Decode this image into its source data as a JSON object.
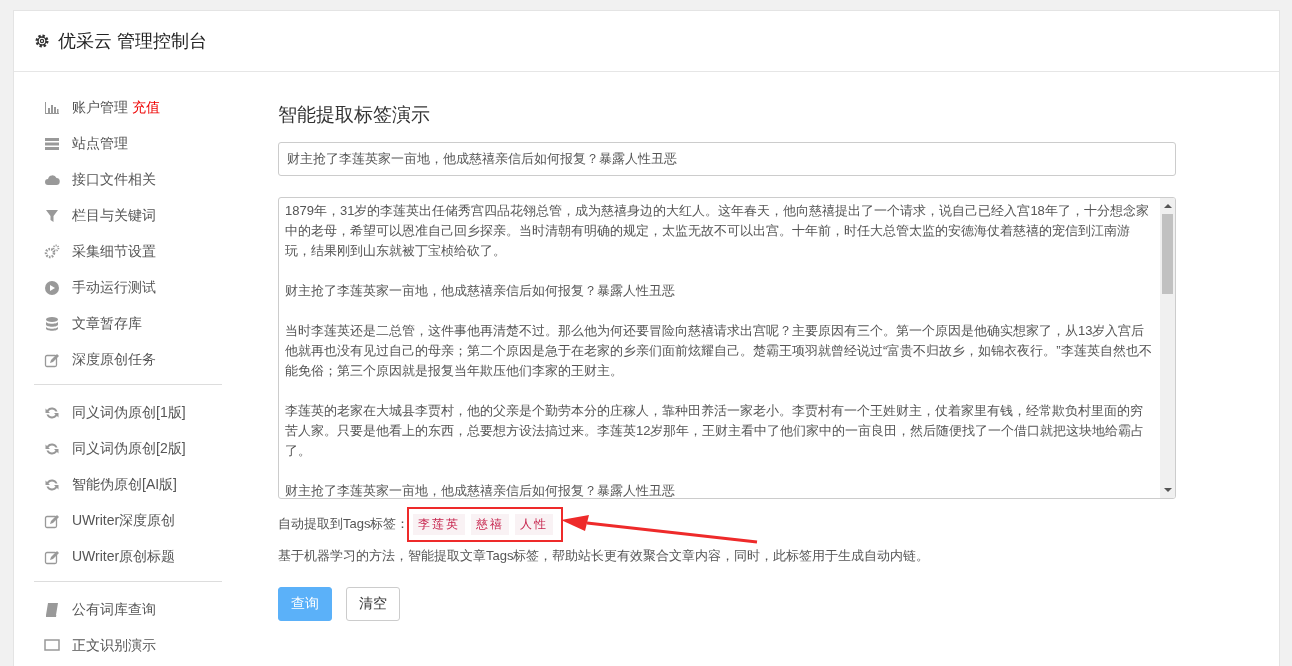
{
  "header": {
    "title": "优采云 管理控制台"
  },
  "sidebar": {
    "groups": [
      {
        "items": [
          {
            "label": "账户管理",
            "link": "充值"
          },
          {
            "label": "站点管理"
          },
          {
            "label": "接口文件相关"
          },
          {
            "label": "栏目与关键词"
          },
          {
            "label": "采集细节设置"
          },
          {
            "label": "手动运行测试"
          },
          {
            "label": "文章暂存库"
          },
          {
            "label": "深度原创任务"
          }
        ]
      },
      {
        "items": [
          {
            "label": "同义词伪原创[1版]"
          },
          {
            "label": "同义词伪原创[2版]"
          },
          {
            "label": "智能伪原创[AI版]"
          },
          {
            "label": "UWriter深度原创"
          },
          {
            "label": "UWriter原创标题"
          }
        ]
      },
      {
        "items": [
          {
            "label": "公有词库查询"
          },
          {
            "label": "正文识别演示"
          }
        ]
      }
    ]
  },
  "main": {
    "title": "智能提取标签演示",
    "title_field": {
      "value": "财主抢了李莲英家一亩地，他成慈禧亲信后如何报复？暴露人性丑恶"
    },
    "content_field": {
      "paragraphs": [
        "1879年，31岁的李莲英出任储秀宫四品花翎总管，成为慈禧身边的大红人。这年春天，他向慈禧提出了一个请求，说自己已经入宫18年了，十分想念家中的老母，希望可以恩准自己回乡探亲。当时清朝有明确的规定，太监无故不可以出宫。十年前，时任大总管太监的安德海仗着慈禧的宠信到江南游玩，结果刚到山东就被丁宝桢给砍了。",
        "财主抢了李莲英家一亩地，他成慈禧亲信后如何报复？暴露人性丑恶",
        "当时李莲英还是二总管，这件事他再清楚不过。那么他为何还要冒险向慈禧请求出宫呢？主要原因有三个。第一个原因是他确实想家了，从13岁入宫后他就再也没有见过自己的母亲；第二个原因是急于在老家的乡亲们面前炫耀自己。楚霸王项羽就曾经说过“富贵不归故乡，如锦衣夜行。”李莲英自然也不能免俗；第三个原因就是报复当年欺压他们李家的王财主。",
        "李莲英的老家在大城县李贾村，他的父亲是个勤劳本分的庄稼人，靠种田养活一家老小。李贾村有一个王姓财主，仗着家里有钱，经常欺负村里面的穷苦人家。只要是他看上的东西，总要想方设法搞过来。李莲英12岁那年，王财主看中了他们家中的一亩良田，然后随便找了一个借口就把这块地给霸占了。",
        "财主抢了李莲英家一亩地，他成慈禧亲信后如何报复？暴露人性丑恶"
      ]
    },
    "tags_label": "自动提取到Tags标签：",
    "tags": [
      "李莲英",
      "慈禧",
      "人性"
    ],
    "description": "基于机器学习的方法，智能提取文章Tags标签，帮助站长更有效聚合文章内容，同时，此标签用于生成自动内链。",
    "buttons": [
      {
        "label": "查询",
        "kind": "primary"
      },
      {
        "label": "清空",
        "kind": "default"
      }
    ]
  }
}
